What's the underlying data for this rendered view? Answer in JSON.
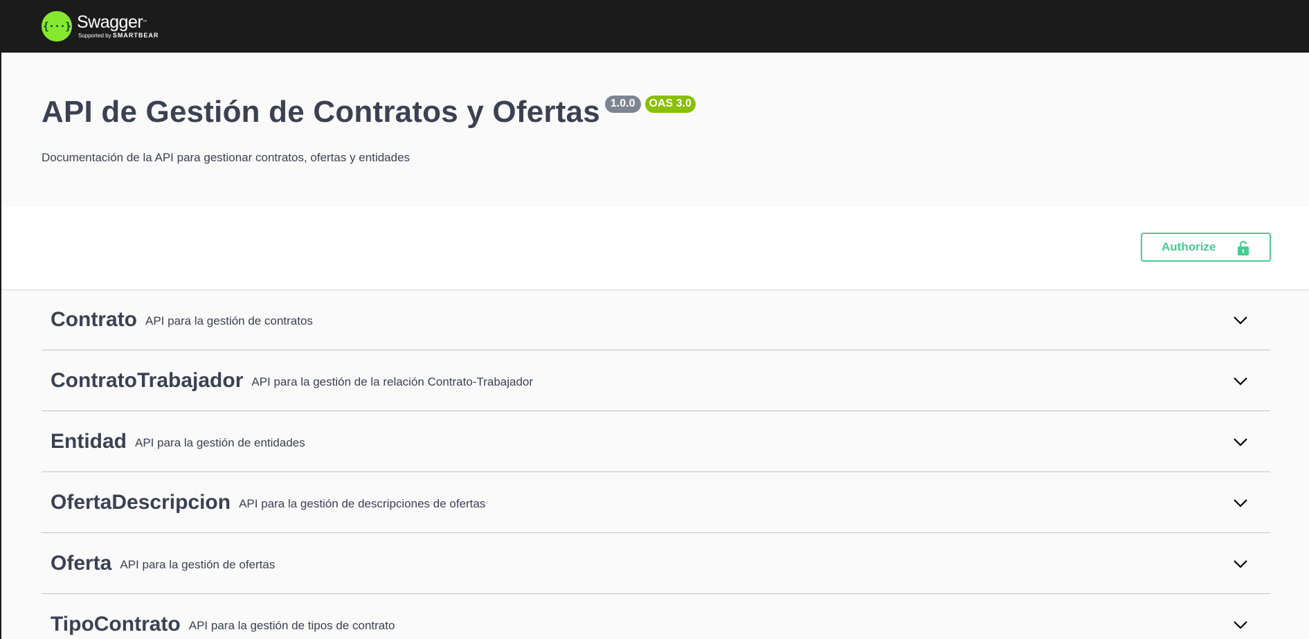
{
  "topbar": {
    "logo_glyph": "{···}",
    "logo_name": "Swagger",
    "logo_tm": "™",
    "logo_supported": "Supported by",
    "logo_brand": "SMARTBEAR"
  },
  "info": {
    "title": "API de Gestión de Contratos y Ofertas",
    "version": "1.0.0",
    "oas": "OAS 3.0",
    "description": "Documentación de la API para gestionar contratos, ofertas y entidades"
  },
  "authorize": {
    "label": "Authorize",
    "icon": "unlocked-lock-icon",
    "color": "#49cc90"
  },
  "tags": [
    {
      "name": "Contrato",
      "description": "API para la gestión de contratos"
    },
    {
      "name": "ContratoTrabajador",
      "description": "API para la gestión de la relación Contrato-Trabajador"
    },
    {
      "name": "Entidad",
      "description": "API para la gestión de entidades"
    },
    {
      "name": "OfertaDescripcion",
      "description": "API para la gestión de descripciones de ofertas"
    },
    {
      "name": "Oferta",
      "description": "API para la gestión de ofertas"
    },
    {
      "name": "TipoContrato",
      "description": "API para la gestión de tipos de contrato"
    }
  ],
  "colors": {
    "topbar": "#1b1b1b",
    "logo": "#85ea2d",
    "version_badge": "#7d8492",
    "oas_badge": "#89bf04",
    "text": "#3b4151"
  }
}
